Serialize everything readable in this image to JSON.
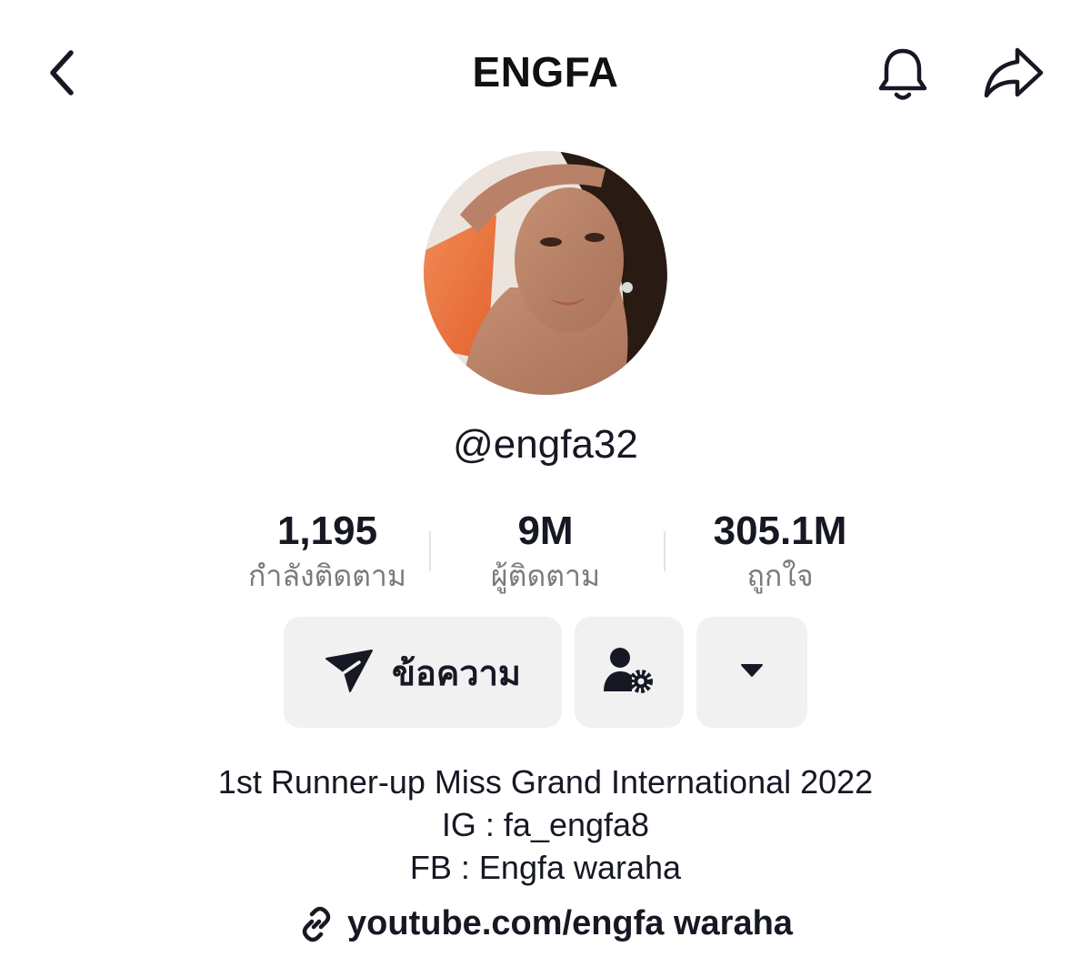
{
  "header": {
    "title": "ENGFA",
    "icons": {
      "back": "chevron-left-icon",
      "bell": "bell-icon",
      "share": "share-arrow-icon"
    }
  },
  "profile": {
    "username": "@engfa32",
    "avatar": "profile-photo"
  },
  "stats": [
    {
      "value": "1,195",
      "label": "กำลังติดตาม"
    },
    {
      "value": "9M",
      "label": "ผู้ติดตาม"
    },
    {
      "value": "305.1M",
      "label": "ถูกใจ"
    }
  ],
  "actions": {
    "message_label": "ข้อความ",
    "message_icon": "send-icon",
    "friends_icon": "user-settings-icon",
    "more_icon": "caret-down-icon"
  },
  "bio": {
    "lines": [
      "1st Runner-up Miss Grand International 2022",
      "IG : fa_engfa8",
      "FB : Engfa waraha"
    ]
  },
  "link": {
    "text": "youtube.com/engfa waraha",
    "icon": "link-icon"
  },
  "colors": {
    "text": "#161823",
    "secondary_text": "#7a7a80",
    "button_bg": "#f1f1f2"
  }
}
